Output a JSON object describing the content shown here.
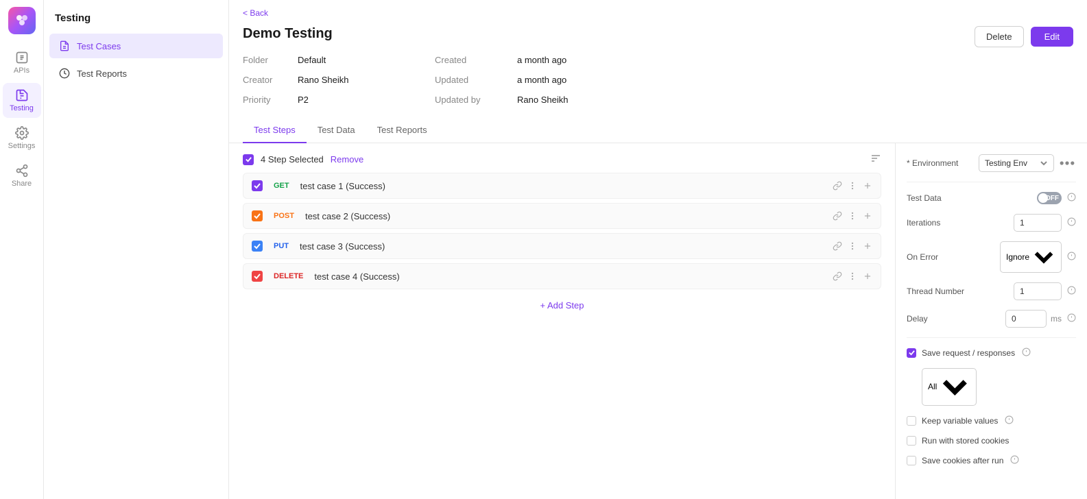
{
  "app": {
    "logo_alt": "App Logo"
  },
  "icon_bar": {
    "items": [
      {
        "id": "apis",
        "label": "APIs",
        "active": false
      },
      {
        "id": "testing",
        "label": "Testing",
        "active": true
      },
      {
        "id": "settings",
        "label": "Settings",
        "active": false
      },
      {
        "id": "share",
        "label": "Share",
        "active": false
      }
    ]
  },
  "sidebar": {
    "title": "Testing",
    "items": [
      {
        "id": "test-cases",
        "label": "Test Cases",
        "active": true
      },
      {
        "id": "test-reports",
        "label": "Test Reports",
        "active": false
      }
    ]
  },
  "back_link": "< Back",
  "page": {
    "title": "Demo Testing",
    "meta": {
      "folder_label": "Folder",
      "folder_value": "Default",
      "creator_label": "Creator",
      "creator_value": "Rano Sheikh",
      "priority_label": "Priority",
      "priority_value": "P2",
      "created_label": "Created",
      "created_value": "a month ago",
      "updated_label": "Updated",
      "updated_value": "a month ago",
      "updated_by_label": "Updated by",
      "updated_by_value": "Rano Sheikh"
    },
    "tabs": [
      {
        "id": "test-steps",
        "label": "Test Steps",
        "active": true
      },
      {
        "id": "test-data",
        "label": "Test Data",
        "active": false
      },
      {
        "id": "test-reports",
        "label": "Test Reports",
        "active": false
      }
    ],
    "delete_btn": "Delete",
    "edit_btn": "Edit"
  },
  "steps_panel": {
    "selection_label": "4 Step Selected",
    "remove_label": "Remove",
    "steps": [
      {
        "id": 1,
        "method": "GET",
        "method_class": "method-get",
        "checkbox_class": "checked",
        "name": "test case 1 (Success)"
      },
      {
        "id": 2,
        "method": "POST",
        "method_class": "method-post",
        "checkbox_class": "checked-orange",
        "name": "test case 2 (Success)"
      },
      {
        "id": 3,
        "method": "PUT",
        "method_class": "method-put",
        "checkbox_class": "checked-blue",
        "name": "test case 3 (Success)"
      },
      {
        "id": 4,
        "method": "DELETE",
        "method_class": "method-delete",
        "checkbox_class": "checked-red",
        "name": "test case 4 (Success)"
      }
    ],
    "add_step_label": "+ Add Step"
  },
  "right_panel": {
    "environment_label": "* Environment",
    "environment_value": "Testing Env",
    "test_data_label": "Test Data",
    "test_data_toggle": "OFF",
    "iterations_label": "Iterations",
    "iterations_value": "1",
    "on_error_label": "On Error",
    "on_error_value": "Ignore",
    "thread_number_label": "Thread Number",
    "thread_number_value": "1",
    "delay_label": "Delay",
    "delay_value": "0",
    "delay_unit": "ms",
    "save_request_label": "Save request / responses",
    "save_request_checked": true,
    "save_all_value": "All",
    "keep_variable_label": "Keep variable values",
    "keep_variable_checked": false,
    "run_cookies_label": "Run with stored cookies",
    "run_cookies_checked": false,
    "save_cookies_label": "Save cookies after run",
    "save_cookies_checked": false
  }
}
